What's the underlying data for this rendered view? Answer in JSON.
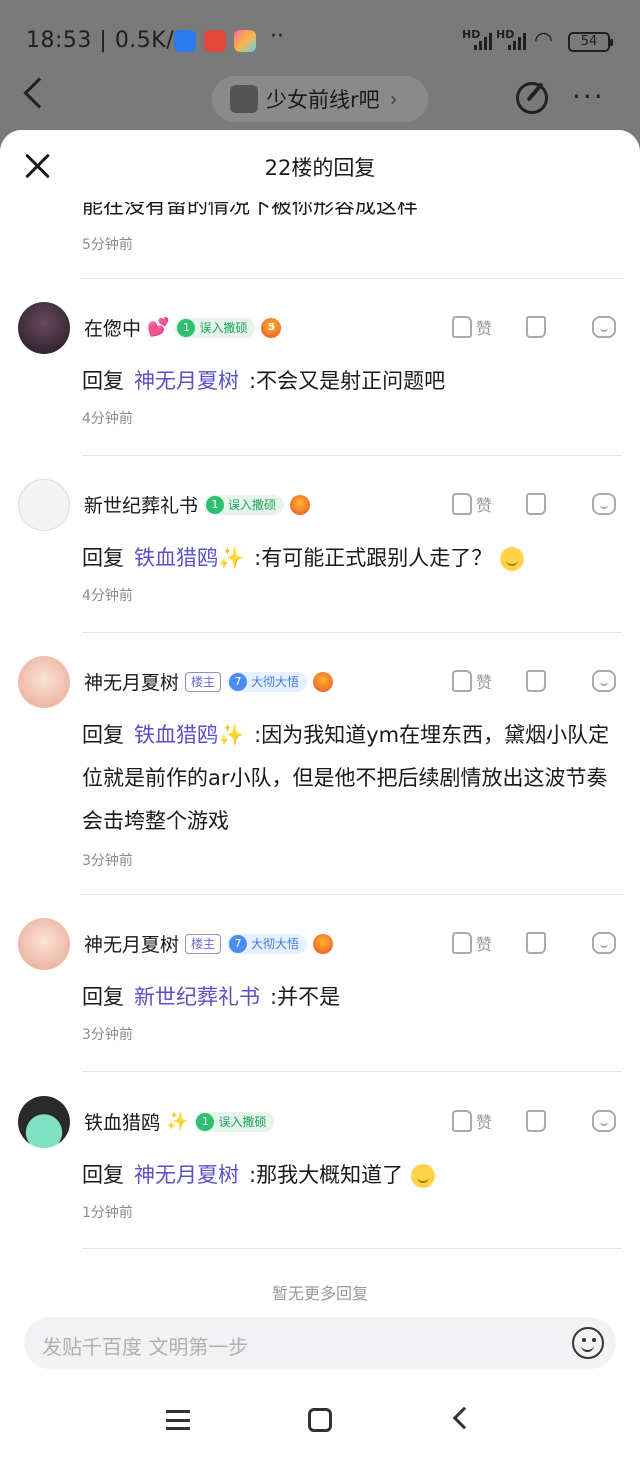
{
  "status_bar": {
    "time": "18:53",
    "speed": "0.5K/s",
    "more": "··",
    "sig1": "HD",
    "sig2": "HD",
    "battery": "54"
  },
  "top_bar": {
    "forum_name": "少女前线r吧",
    "chevron": "›"
  },
  "sheet": {
    "title": "22楼的回复"
  },
  "previous": {
    "text": "能在没有留的情况下被你形容成这样",
    "time": "5分钟前"
  },
  "replies": [
    {
      "user": "在偬中",
      "suffix": "💕",
      "level": "1",
      "level_title": "误入撒硕",
      "role": "",
      "medal": "5",
      "reply_word": "回复",
      "target": "神无月夏树",
      "text": ":不会又是射正问题吧",
      "emoji": false,
      "lines": 1,
      "time": "4分钟前",
      "like": "赞"
    },
    {
      "user": "新世纪葬礼书",
      "suffix": "",
      "level": "1",
      "level_title": "误入撒硕",
      "role": "",
      "medal": "",
      "reply_word": "回复",
      "target": "铁血猎鸥✨",
      "text": ":有可能正式跟别人走了？",
      "emoji": true,
      "lines": 1,
      "time": "4分钟前",
      "like": "赞"
    },
    {
      "user": "神无月夏树",
      "suffix": "",
      "level": "7",
      "level_title": "大彻大悟",
      "role": "楼主",
      "medal": "",
      "reply_word": "回复",
      "target": "铁血猎鸥✨",
      "text": ":因为我知道ym在埋东西，黛烟小队定位就是前作的ar小队，但是他不把后续剧情放出这波节奏会击垮整个游戏",
      "emoji": false,
      "lines": 3,
      "time": "3分钟前",
      "like": "赞"
    },
    {
      "user": "神无月夏树",
      "suffix": "",
      "level": "7",
      "level_title": "大彻大悟",
      "role": "楼主",
      "medal": "",
      "reply_word": "回复",
      "target": "新世纪葬礼书",
      "text": ":并不是",
      "emoji": false,
      "lines": 1,
      "time": "3分钟前",
      "like": "赞"
    },
    {
      "user": "铁血猎鸥",
      "suffix": "✨",
      "level": "1",
      "level_title": "误入撒硕",
      "role": "",
      "medal": "",
      "reply_word": "回复",
      "target": "神无月夏树",
      "text": ":那我大概知道了",
      "emoji": true,
      "lines": 1,
      "time": "1分钟前",
      "like": "赞"
    }
  ],
  "no_more": "暂无更多回复",
  "input": {
    "placeholder": "发贴千百度 文明第一步"
  }
}
